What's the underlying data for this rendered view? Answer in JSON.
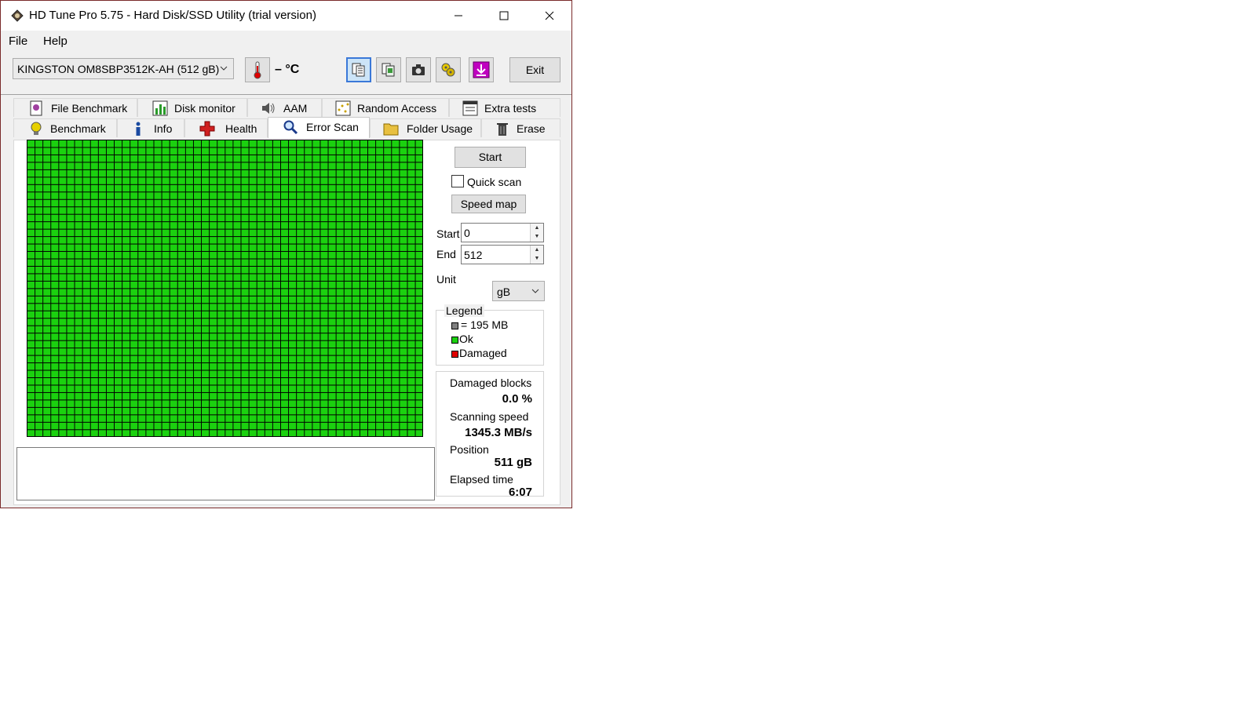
{
  "window": {
    "title": "HD Tune Pro 5.75 - Hard Disk/SSD Utility (trial version)"
  },
  "menu": {
    "file": "File",
    "help": "Help"
  },
  "toolbar": {
    "drive": "KINGSTON OM8SBP3512K-AH (512 gB)",
    "temperature": "– °C",
    "exit_label": "Exit"
  },
  "tabs": {
    "row1": [
      {
        "label": "File Benchmark",
        "icon": "file-benchmark-icon"
      },
      {
        "label": "Disk monitor",
        "icon": "disk-monitor-icon"
      },
      {
        "label": "AAM",
        "icon": "speaker-icon"
      },
      {
        "label": "Random Access",
        "icon": "random-access-icon"
      },
      {
        "label": "Extra tests",
        "icon": "extra-tests-icon"
      }
    ],
    "row2": [
      {
        "label": "Benchmark",
        "icon": "lightbulb-icon"
      },
      {
        "label": "Info",
        "icon": "info-icon"
      },
      {
        "label": "Health",
        "icon": "health-cross-icon"
      },
      {
        "label": "Error Scan",
        "icon": "magnifier-icon",
        "active": true
      },
      {
        "label": "Folder Usage",
        "icon": "folder-icon"
      },
      {
        "label": "Erase",
        "icon": "trash-icon"
      }
    ]
  },
  "scan": {
    "start_button": "Start",
    "quick_scan_label": "Quick scan",
    "quick_scan_checked": false,
    "speed_map_button": "Speed map",
    "start_label": "Start",
    "start_value": "0",
    "end_label": "End",
    "end_value": "512",
    "unit_label": "Unit",
    "unit_value": "gB"
  },
  "legend": {
    "title": "Legend",
    "block_size": "= 195 MB",
    "ok": "Ok",
    "damaged": "Damaged",
    "colors": {
      "block": "#808080",
      "ok": "#1bd10f",
      "damaged": "#e00000"
    }
  },
  "stats": {
    "damaged_blocks_label": "Damaged blocks",
    "damaged_blocks_value": "0.0 %",
    "scanning_speed_label": "Scanning speed",
    "scanning_speed_value": "1345.3 MB/s",
    "position_label": "Position",
    "position_value": "511 gB",
    "elapsed_label": "Elapsed time",
    "elapsed_value": "6:07"
  }
}
